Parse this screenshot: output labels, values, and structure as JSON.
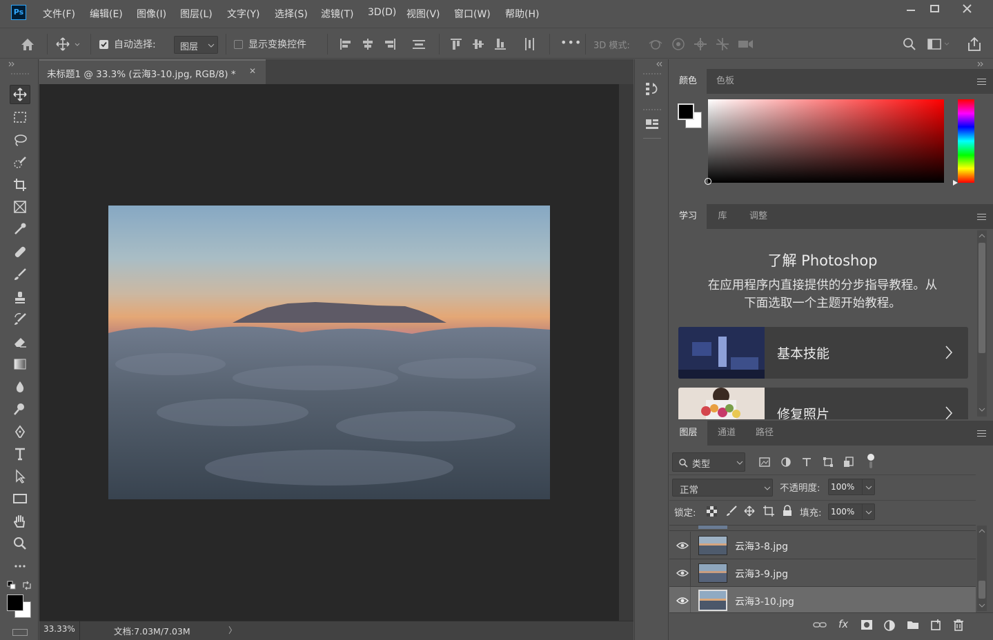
{
  "app": {
    "logo": "Ps"
  },
  "menu": [
    "文件(F)",
    "编辑(E)",
    "图像(I)",
    "图层(L)",
    "文字(Y)",
    "选择(S)",
    "滤镜(T)",
    "3D(D)",
    "视图(V)",
    "窗口(W)",
    "帮助(H)"
  ],
  "window_controls": {
    "minimize": "—",
    "maximize": "☐",
    "close": "✕"
  },
  "options": {
    "auto_select_label": "自动选择:",
    "auto_select_checked": true,
    "auto_select_value": "图层",
    "show_transform_label": "显示变换控件",
    "show_transform_checked": false,
    "more": "•••",
    "mode_3d_label": "3D 模式:"
  },
  "document": {
    "tab_title": "未标题1 @ 33.3% (云海3-10.jpg, RGB/8) *",
    "tab_close": "✕",
    "zoom": "33.33%",
    "doc_size": "文档:7.03M/7.03M",
    "status_arrow": "〉"
  },
  "tools": [
    "move-tool",
    "marquee-tool",
    "lasso-tool",
    "quick-select-tool",
    "crop-tool",
    "frame-tool",
    "eyedropper-tool",
    "healing-tool",
    "brush-tool",
    "stamp-tool",
    "history-brush-tool",
    "eraser-tool",
    "gradient-tool",
    "blur-tool",
    "dodge-tool",
    "pen-tool",
    "type-tool",
    "path-select-tool",
    "rectangle-tool",
    "hand-tool",
    "zoom-tool",
    "more-tools"
  ],
  "colors": {
    "foreground": "#000000",
    "background": "#ffffff",
    "accent": "#31a8ff",
    "picker_hue": "#ff0000"
  },
  "color_panel": {
    "tabs": [
      "颜色",
      "色板"
    ],
    "active": 0
  },
  "learn_panel": {
    "tabs": [
      "学习",
      "库",
      "调整"
    ],
    "active": 0,
    "heading": "了解 Photoshop",
    "description_line1": "在应用程序内直接提供的分步指导教程。从",
    "description_line2": "下面选取一个主题开始教程。",
    "cards": [
      {
        "title": "基本技能"
      },
      {
        "title": "修复照片"
      }
    ]
  },
  "layers_panel": {
    "tabs": [
      "图层",
      "通道",
      "路径"
    ],
    "active": 0,
    "filter_label": "类型",
    "blend_mode": "正常",
    "opacity_label": "不透明度:",
    "opacity_value": "100%",
    "lock_label": "锁定:",
    "fill_label": "填充:",
    "fill_value": "100%",
    "layers": [
      {
        "name": "云海3-8.jpg",
        "visible": true,
        "selected": false
      },
      {
        "name": "云海3-9.jpg",
        "visible": true,
        "selected": false
      },
      {
        "name": "云海3-10.jpg",
        "visible": true,
        "selected": true
      }
    ],
    "footer_fx": "fx"
  }
}
